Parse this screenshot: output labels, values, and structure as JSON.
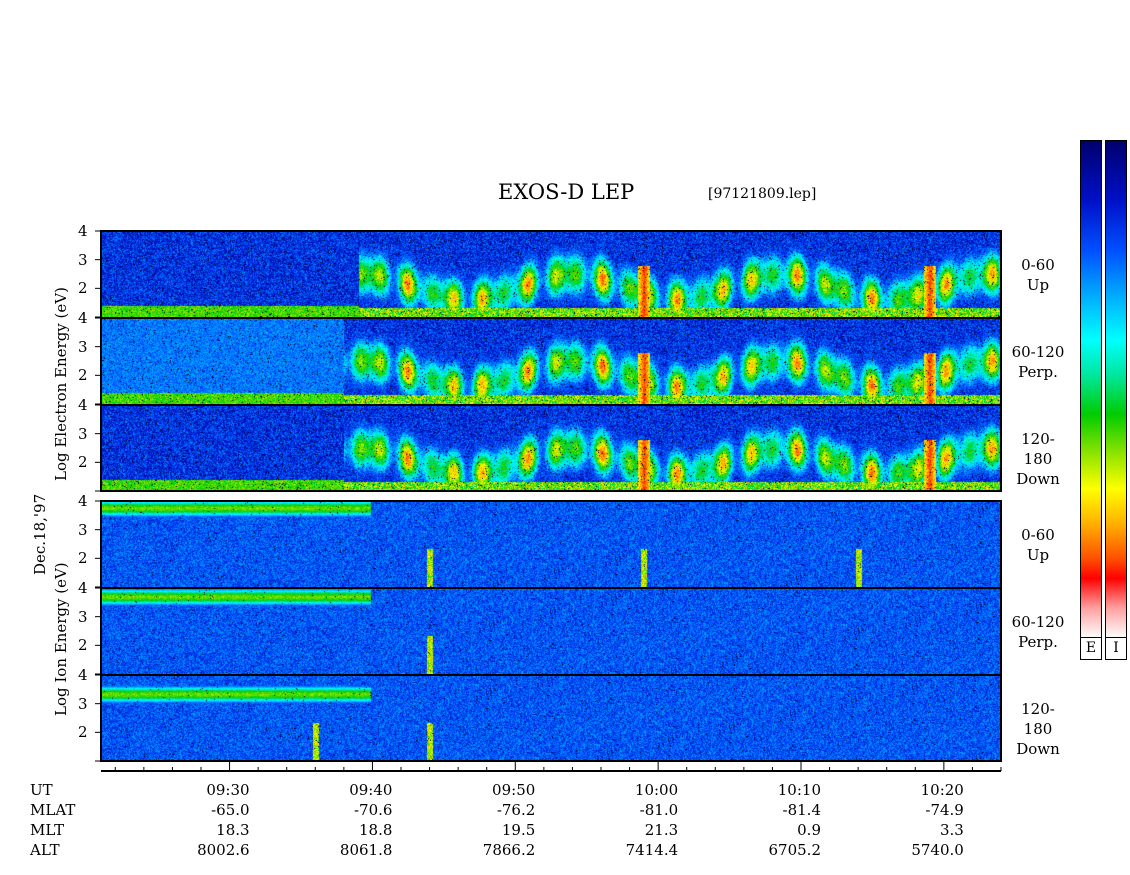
{
  "title": "EXOS-D LEP",
  "file_label": "[97121809.lep]",
  "date_label": "Dec.18,'97",
  "electron_ylabel": "Log Electron Energy (eV)",
  "ion_ylabel": "Log Ion Energy (eV)",
  "y_ticks": [
    "1",
    "2",
    "3",
    "4"
  ],
  "panels": [
    {
      "species": "electron",
      "label_top": "0-60",
      "label_bottom": "Up"
    },
    {
      "species": "electron",
      "label_top": "60-120",
      "label_bottom": "Perp."
    },
    {
      "species": "electron",
      "label_top": "120-180",
      "label_bottom": "Down"
    },
    {
      "species": "ion",
      "label_top": "0-60",
      "label_bottom": "Up"
    },
    {
      "species": "ion",
      "label_top": "60-120",
      "label_bottom": "Perp."
    },
    {
      "species": "ion",
      "label_top": "120-180",
      "label_bottom": "Down"
    }
  ],
  "colorbars": [
    {
      "label": "E"
    },
    {
      "label": "I"
    }
  ],
  "colors": {
    "background": "#00006e",
    "low": "#0020d0",
    "mid": "#00ffff",
    "high": "#00cc00",
    "peak": "#ffff00",
    "max": "#ff0000"
  },
  "axis_rows": {
    "labels": [
      "UT",
      "MLAT",
      "MLT",
      "ALT"
    ],
    "UT": [
      "09:30",
      "09:40",
      "09:50",
      "10:00",
      "10:10",
      "10:20"
    ],
    "MLAT": [
      "-65.0",
      "-70.6",
      "-76.2",
      "-81.0",
      "-81.4",
      "-74.9"
    ],
    "MLT": [
      "18.3",
      "18.8",
      "19.5",
      "21.3",
      "0.9",
      "3.3"
    ],
    "ALT": [
      "8002.6",
      "8061.8",
      "7866.2",
      "7414.4",
      "6705.2",
      "5740.0"
    ]
  },
  "chart_data": {
    "type": "heatmap",
    "title": "EXOS-D LEP",
    "x_unit": "UT",
    "x_range": [
      "09:21",
      "10:24"
    ],
    "y_range": [
      1,
      4
    ],
    "y_scale": "log10 energy (eV)",
    "x_ticks": [
      "09:30",
      "09:40",
      "09:50",
      "10:00",
      "10:10",
      "10:20"
    ],
    "series": [
      {
        "name": "Electron 0-60 Up",
        "activity_onset": "09:39",
        "intense_bursts": [
          "09:59",
          "10:19"
        ]
      },
      {
        "name": "Electron 60-120 Perp.",
        "activity_onset": "09:38",
        "intense_bursts": [
          "09:59",
          "10:19"
        ]
      },
      {
        "name": "Electron 120-180 Down",
        "activity_onset": "09:38",
        "intense_bursts": [
          "09:59",
          "10:19"
        ]
      },
      {
        "name": "Ion 0-60 Up",
        "activity_onset": "09:22",
        "intense_bursts": [
          "09:44",
          "09:59",
          "10:14"
        ]
      },
      {
        "name": "Ion 60-120 Perp.",
        "activity_onset": "09:22",
        "intense_bursts": [
          "09:44"
        ]
      },
      {
        "name": "Ion 120-180 Down",
        "activity_onset": "09:22",
        "intense_bursts": [
          "09:36",
          "09:44"
        ]
      }
    ]
  }
}
